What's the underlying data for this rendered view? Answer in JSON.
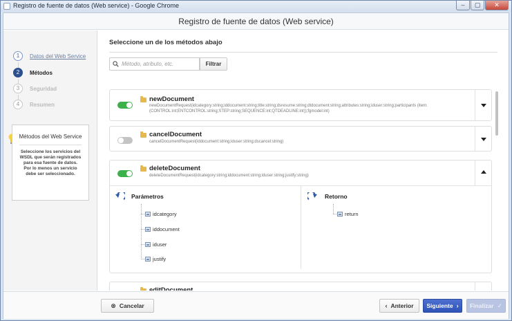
{
  "browser": {
    "window_title": "Registro de fuente de datos (Web service) - Google Chrome",
    "controls": [
      "–",
      "▢",
      "✕"
    ]
  },
  "dialog": {
    "title": "Registro de fuente de datos (Web service)"
  },
  "steps": [
    {
      "num": "1",
      "label": "Datos del Web Service",
      "state": "done"
    },
    {
      "num": "2",
      "label": "Métodos",
      "state": "active"
    },
    {
      "num": "3",
      "label": "Seguridad",
      "state": "pending"
    },
    {
      "num": "4",
      "label": "Resumen",
      "state": "pending"
    }
  ],
  "info": {
    "title": "Métodos del Web Service",
    "text": "Seleccione los servicios del WSDL que serán registrados para esa fuente de datos. Por lo menos un servicio debe ser seleccionado."
  },
  "main": {
    "heading": "Seleccione un de los métodos abajo",
    "search_placeholder": "Método, atributo, etc.",
    "filter_label": "Filtrar"
  },
  "methods": [
    {
      "name": "newDocument",
      "signature": "newDocumentRequest(idcategory:string;iddocument:string;title:string;dsresume:string;dtdocument:string;attributes:string;iduser:string;participants (item: (CONTROL:int;ENTCONTROL:string;STEP:string;SEQUENCE:int;QTDEADLINE:int));fgmodel:int)",
      "enabled": true,
      "expanded": false
    },
    {
      "name": "cancelDocument",
      "signature": "cancelDocumentRequest(iddocument:string;iduser:string;dscancel:string)",
      "enabled": false,
      "expanded": false
    },
    {
      "name": "deleteDocument",
      "signature": "deleteDocumentRequest(idcategory:string;iddocument:string;iduser:string;justify:string)",
      "enabled": true,
      "expanded": true,
      "params_title": "Parámetros",
      "params": [
        "idcategory",
        "iddocument",
        "iduser",
        "justify"
      ],
      "return_title": "Retorno",
      "returns": [
        "return"
      ]
    },
    {
      "name": "editDocument",
      "signature": "",
      "enabled": true,
      "expanded": false
    }
  ],
  "footer": {
    "cancel": "Cancelar",
    "prev": "Anterior",
    "next": "Siguiente",
    "finish": "Finalizar"
  },
  "colors": {
    "accent": "#2f53b8",
    "toggle_on": "#3bb04b",
    "step_active": "#2c4f8e"
  }
}
